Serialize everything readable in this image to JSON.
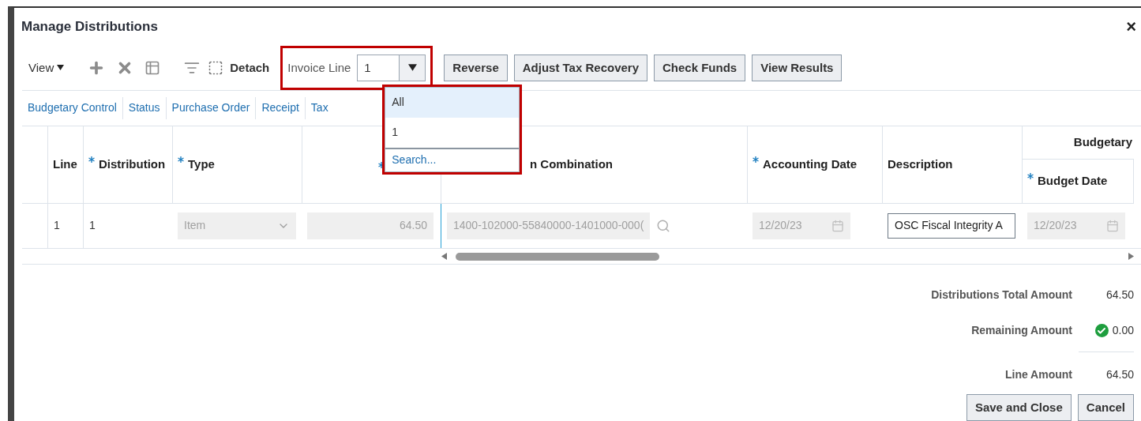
{
  "dialog": {
    "title": "Manage Distributions",
    "close": "×"
  },
  "toolbar": {
    "view_menu": "View",
    "detach": "Detach",
    "invoice_line": {
      "label": "Invoice Line",
      "value": "1"
    },
    "buttons": [
      "Reverse",
      "Adjust Tax Recovery",
      "Check Funds",
      "View Results"
    ]
  },
  "dropdown": {
    "options": [
      {
        "label": "All",
        "selected": true
      },
      {
        "label": "1",
        "selected": false
      }
    ],
    "search_link": "Search..."
  },
  "links": [
    "Budgetary Control",
    "Status",
    "Purchase Order",
    "Receipt",
    "Tax"
  ],
  "table": {
    "columns": [
      {
        "label": "Line",
        "required": false
      },
      {
        "label": "Distribution",
        "required": true
      },
      {
        "label": "Type",
        "required": true
      },
      {
        "required": true
      },
      {
        "label": "n Combination",
        "required": false
      },
      {
        "label": "Accounting Date",
        "required": true
      },
      {
        "label": "Description",
        "required": false
      }
    ],
    "group": {
      "label": "Budgetary",
      "columns": [
        {
          "label": "Budget Date",
          "required": true
        }
      ]
    },
    "rows": [
      {
        "cells": [
          {
            "kind": "text",
            "value": "1"
          },
          {
            "kind": "text",
            "value": "1"
          },
          {
            "kind": "select",
            "value": "Item",
            "disabled": true
          },
          {
            "kind": "number",
            "value": "64.50",
            "disabled": true
          },
          {
            "kind": "lookup",
            "value": "1400-102000-55840000-1401000-000(",
            "disabled": true
          },
          {
            "kind": "date",
            "value": "12/20/23",
            "disabled": true
          },
          {
            "kind": "input",
            "value": "OSC Fiscal Integrity A",
            "disabled": false
          },
          {
            "kind": "date",
            "value": "12/20/23",
            "disabled": true
          }
        ]
      }
    ]
  },
  "summary": [
    {
      "label": "Distributions Total Amount",
      "value": "64.50",
      "kind": "plain"
    },
    {
      "label": "Remaining Amount",
      "value": "0.00",
      "kind": "balanced"
    },
    {
      "label": "Line Amount",
      "value": "64.50",
      "kind": "plain"
    }
  ],
  "footer_buttons": [
    "Save and Close",
    "Cancel"
  ]
}
